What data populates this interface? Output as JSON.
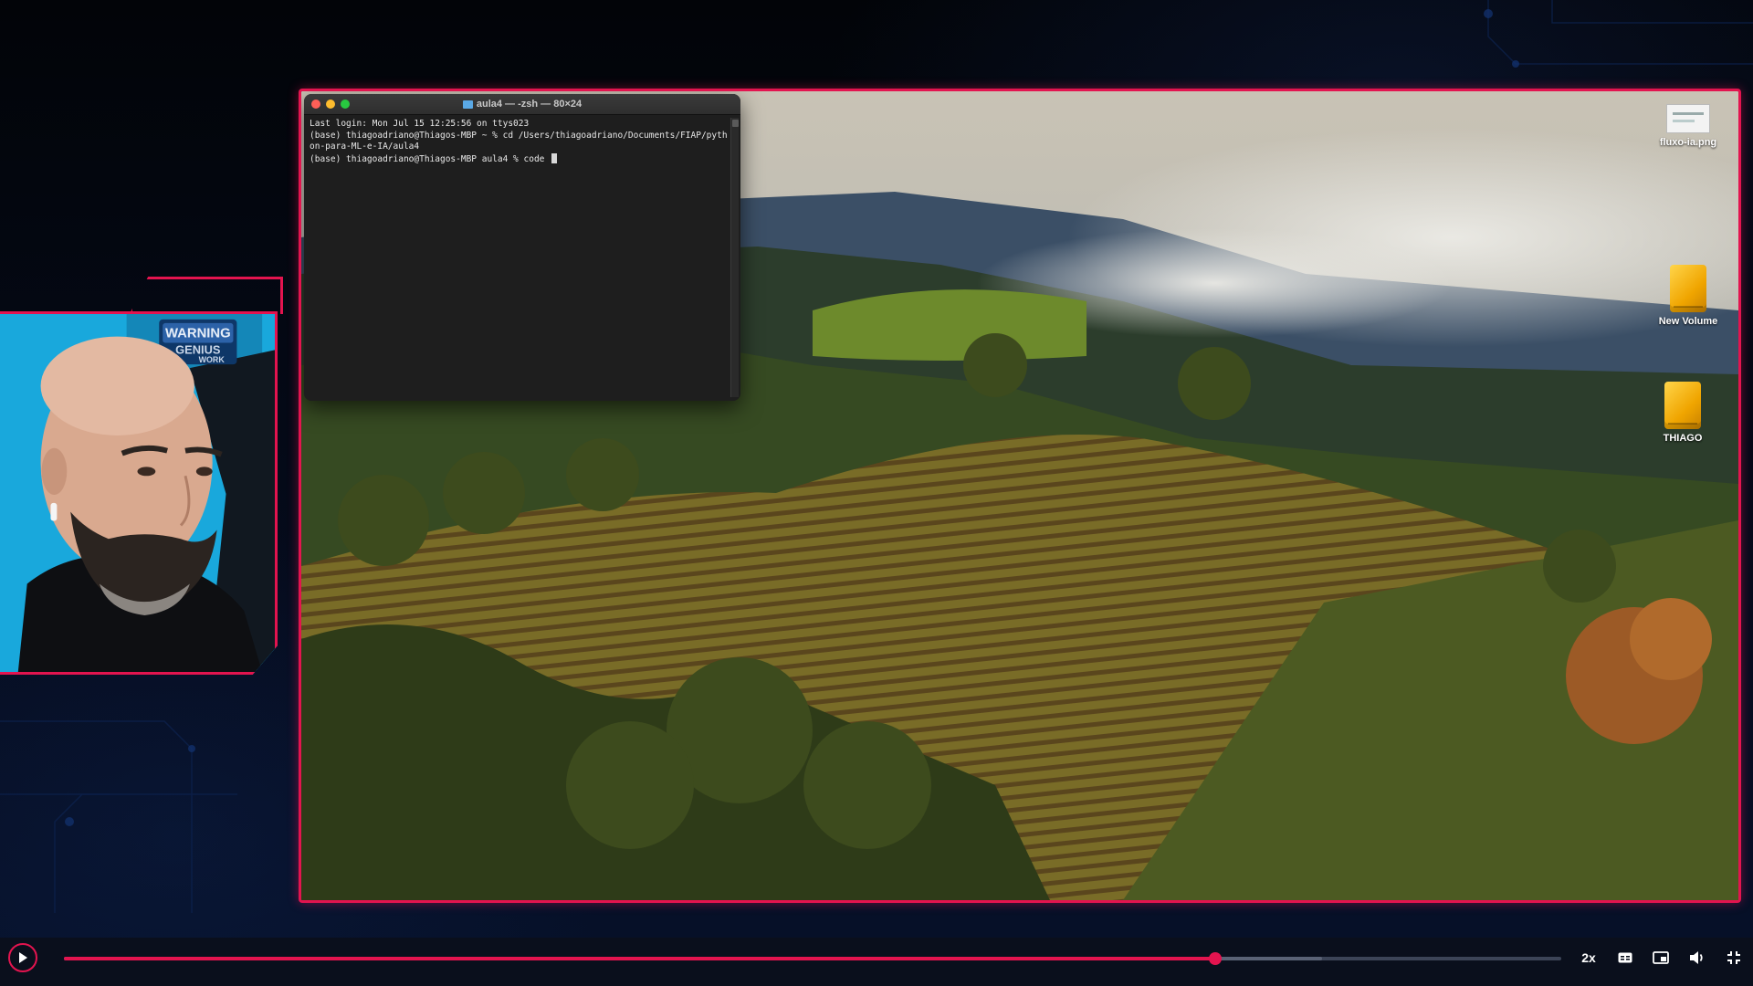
{
  "terminal": {
    "title": "aula4 — -zsh — 80×24",
    "lines": [
      "Last login: Mon Jul 15 12:25:56 on ttys023",
      "(base) thiagoadriano@Thiagos-MBP ~ % cd /Users/thiagoadriano/Documents/FIAP/pyth",
      "on-para-ML-e-IA/aula4",
      "(base) thiagoadriano@Thiagos-MBP aula4 % code "
    ]
  },
  "desktop": {
    "icons": [
      {
        "label": "fluxo-ia.png",
        "icon": "image-file-icon"
      },
      {
        "label": "New Volume",
        "icon": "drive-icon"
      },
      {
        "label": "THIAGO",
        "icon": "drive-icon"
      }
    ]
  },
  "webcam": {
    "sign_line1": "WARNING",
    "sign_line2": "GENIUS",
    "sign_line3": "WORK"
  },
  "player": {
    "progress": 0.769,
    "buffered": 0.84,
    "speed_label": "2x",
    "controls": [
      "play-icon",
      "subtitles-icon",
      "picture-in-picture-icon",
      "volume-icon",
      "exit-fullscreen-icon"
    ]
  },
  "colors": {
    "accent": "#e3144f",
    "background": "#03060f",
    "terminal_bg": "#1e1e1e"
  }
}
